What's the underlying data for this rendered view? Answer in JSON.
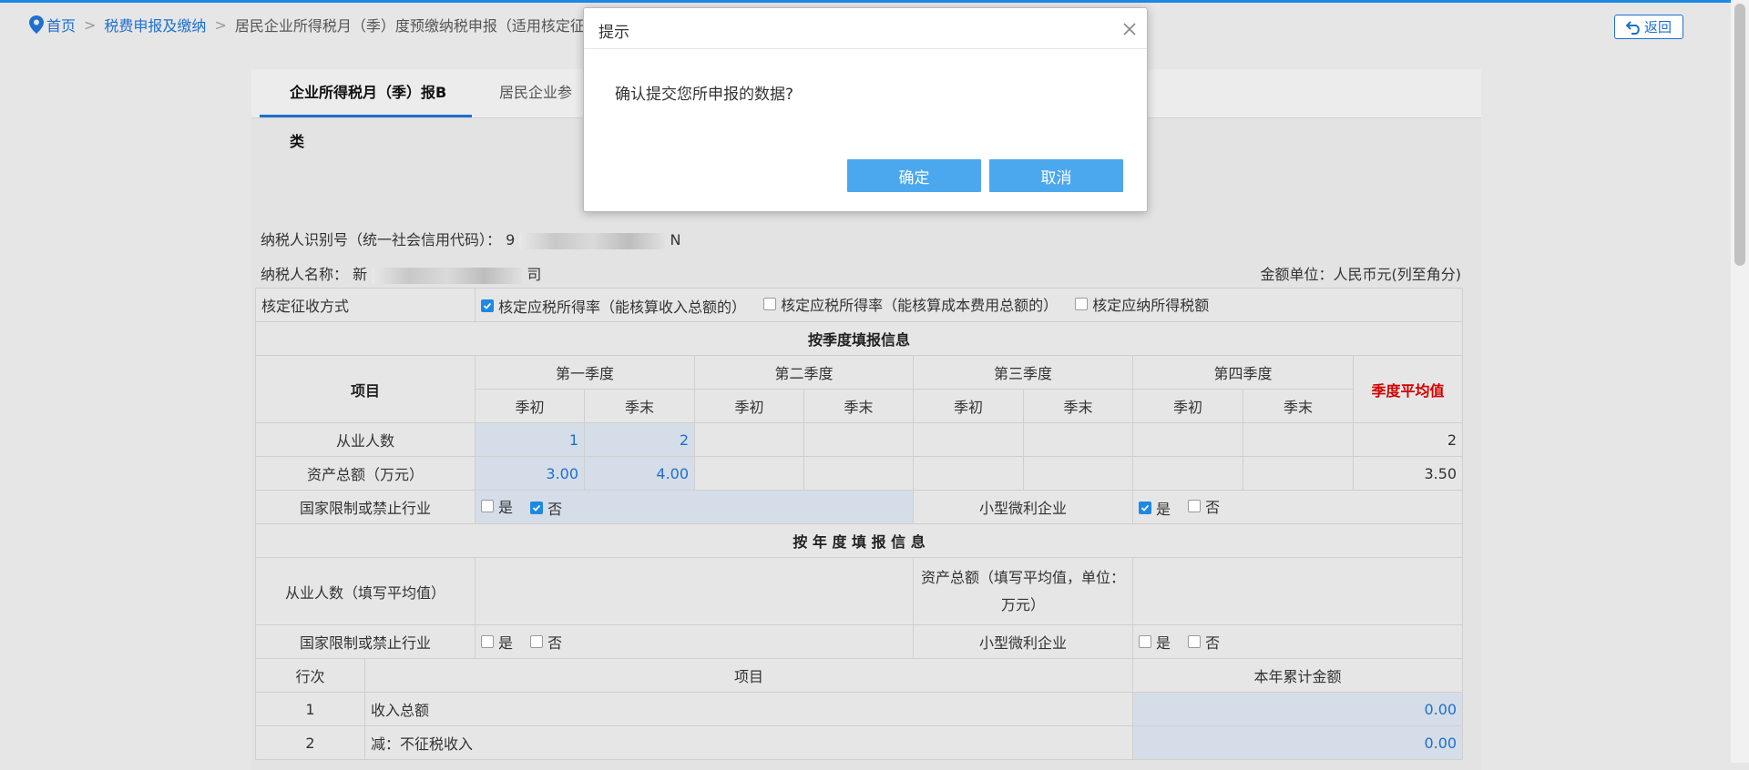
{
  "breadcrumb": {
    "home": "首页",
    "separator": ">",
    "section": "税费申报及缴纳",
    "current": "居民企业所得税月（季）度预缴纳税申报（适用核定征收"
  },
  "back_button": "返回",
  "tabs": [
    "企业所得税月（季）报B类",
    "居民企业参"
  ],
  "taxpayer": {
    "id_label": "纳税人识别号（统一社会信用代码）：",
    "id_prefix": "9",
    "id_suffix": "N",
    "name_label": "纳税人名称：",
    "name_prefix": "新",
    "name_suffix": "司"
  },
  "amount_unit": "金额单位：人民币元(列至角分)",
  "form": {
    "method_label": "核定征收方式",
    "method_options": [
      {
        "label": "核定应税所得率（能核算收入总额的）",
        "checked": true
      },
      {
        "label": "核定应税所得率（能核算成本费用总额的）",
        "checked": false
      },
      {
        "label": "核定应纳所得税额",
        "checked": false
      }
    ],
    "quarterly_title": "按季度填报信息",
    "item_header": "项目",
    "quarters": [
      "第一季度",
      "第二季度",
      "第三季度",
      "第四季度"
    ],
    "avg_header": "季度平均值",
    "sub_headers": [
      "季初",
      "季末"
    ],
    "employees_label": "从业人数",
    "employees": [
      "1",
      "2",
      "",
      "",
      "",
      "",
      "",
      ""
    ],
    "employees_avg": "2",
    "assets_label": "资产总额（万元）",
    "assets": [
      "3.00",
      "4.00",
      "",
      "",
      "",
      "",
      "",
      ""
    ],
    "assets_avg": "3.50",
    "restricted_label": "国家限制或禁止行业",
    "small_label": "小型微利企业",
    "yes": "是",
    "no": "否",
    "annual_title": "按 年 度 填 报 信 息",
    "annual_employees_label": "从业人数（填写平均值）",
    "annual_assets_label_1": "资产总额（填写平均值，单位：",
    "annual_assets_label_2": "万元）",
    "row_header": "行次",
    "project_header": "项目",
    "amount_header": "本年累计金额",
    "rows": [
      {
        "no": "1",
        "label": "收入总额",
        "amount": "0.00"
      },
      {
        "no": "2",
        "label": "减：不征税收入",
        "amount": "0.00"
      }
    ]
  },
  "modal": {
    "title": "提示",
    "message": "确认提交您所申报的数据?",
    "ok": "确定",
    "cancel": "取消"
  },
  "colors": {
    "accent": "#1e6fd0",
    "button": "#4ba8ef",
    "avg_header": "#d40000",
    "checkbox": "#1e88e5"
  }
}
